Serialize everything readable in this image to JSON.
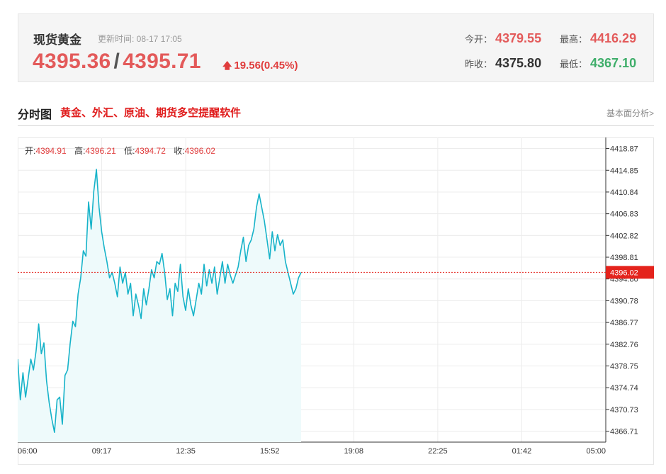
{
  "quote": {
    "title": "现货黄金",
    "updated": "更新时间: 08-17 17:05",
    "bid": "4395.36",
    "ask": "4395.71",
    "change": "19.56(0.45%)",
    "open_label": "今开：",
    "open": "4379.55",
    "high_label": "最高：",
    "high": "4416.29",
    "prev_label": "昨收：",
    "prev": "4375.80",
    "low_label": "最低：",
    "low": "4367.10"
  },
  "section": {
    "title": "分时图",
    "ad": "黄金、外汇、原油、期货多空提醒软件",
    "link": "基本面分析>"
  },
  "ohlc": {
    "open_label": "开:",
    "open": "4394.91",
    "high_label": "高:",
    "high": "4396.21",
    "low_label": "低:",
    "low": "4394.72",
    "close_label": "收:",
    "close": "4396.02"
  },
  "colors": {
    "up": "#e35a5a",
    "down": "#3fae6a",
    "line": "#17b3c9",
    "fill": "#eefafb",
    "marker": "#e4231c"
  },
  "chart_data": {
    "type": "area",
    "current_value": "4396.02",
    "y_ticks": [
      "4418.87",
      "4414.85",
      "4410.84",
      "4406.83",
      "4402.82",
      "4398.81",
      "4394.80",
      "4390.78",
      "4386.77",
      "4382.76",
      "4378.75",
      "4374.74",
      "4370.73",
      "4366.71"
    ],
    "x_ticks": [
      "06:00",
      "09:17",
      "12:35",
      "15:52",
      "19:08",
      "22:25",
      "01:42",
      "05:00"
    ],
    "ylim": [
      4364.7,
      4420.9
    ],
    "grid": true,
    "series": [
      {
        "values": [
          4380.0,
          4372.5,
          4377.5,
          4373.0,
          4376.5,
          4380.0,
          4378.0,
          4381.5,
          4386.5,
          4381.0,
          4383.0,
          4376.0,
          4372.0,
          4369.0,
          4366.5,
          4372.5,
          4373.0,
          4368.0,
          4377.0,
          4378.0,
          4383.0,
          4387.0,
          4386.0,
          4392.0,
          4395.0,
          4400.0,
          4399.0,
          4409.0,
          4404.0,
          4411.0,
          4415.0,
          4408.0,
          4403.5,
          4400.5,
          4398.0,
          4395.0,
          4396.0,
          4394.0,
          4391.5,
          4397.0,
          4394.0,
          4396.0,
          4392.0,
          4394.0,
          4388.0,
          4392.0,
          4390.0,
          4387.5,
          4393.0,
          4390.0,
          4393.0,
          4396.5,
          4395.0,
          4398.0,
          4397.5,
          4399.5,
          4396.0,
          4391.0,
          4393.0,
          4388.0,
          4394.0,
          4392.5,
          4397.5,
          4391.5,
          4389.0,
          4393.0,
          4390.0,
          4388.0,
          4391.0,
          4394.0,
          4392.0,
          4397.5,
          4393.5,
          4396.5,
          4394.0,
          4397.0,
          4392.0,
          4395.0,
          4398.0,
          4394.0,
          4397.5,
          4395.5,
          4394.0,
          4395.5,
          4397.0,
          4400.0,
          4402.5,
          4398.0,
          4401.0,
          4402.0,
          4404.0,
          4408.0,
          4410.5,
          4408.0,
          4405.5,
          4402.0,
          4398.5,
          4403.5,
          4400.0,
          4403.0,
          4401.0,
          4402.0,
          4398.0,
          4396.0,
          4394.0,
          4392.0,
          4393.0,
          4395.0,
          4396.02
        ]
      }
    ]
  }
}
